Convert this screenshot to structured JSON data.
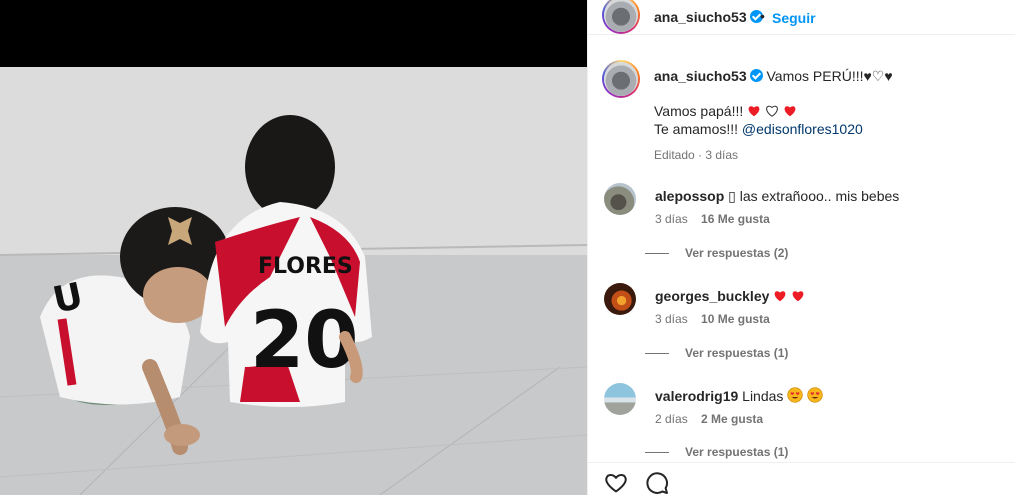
{
  "header": {
    "username": "ana_siucho53",
    "separator": "•",
    "follow_label": "Seguir"
  },
  "caption": {
    "username": "ana_siucho53",
    "text_line1": "Vamos PERÚ!!!♥♡♥",
    "text_line2": "Vamos papá!!!",
    "text_line3": "Te amamos!!!",
    "mention": "@edisonflores1020",
    "meta": "Editado · 3 días"
  },
  "comments": [
    {
      "username": "alepossop",
      "text": "▯ las extrañooo.. mis bebes",
      "time": "3 días",
      "likes": "16 Me gusta",
      "replies": "Ver respuestas (2)"
    },
    {
      "username": "georges_buckley",
      "text": "",
      "time": "3 días",
      "likes": "10 Me gusta",
      "replies": "Ver respuestas (1)"
    },
    {
      "username": "valerodrig19",
      "text": "Lindas",
      "time": "2 días",
      "likes": "2 Me gusta",
      "replies": "Ver respuestas (1)"
    }
  ],
  "photo": {
    "jersey_name": "FLORES",
    "jersey_number": "20"
  },
  "colors": {
    "link": "#0095f6",
    "mention": "#00376b",
    "heart": "#ed1c24",
    "jersey_red": "#c8102e"
  },
  "icons": [
    "verified-badge-icon",
    "heart-icon",
    "comment-icon"
  ]
}
